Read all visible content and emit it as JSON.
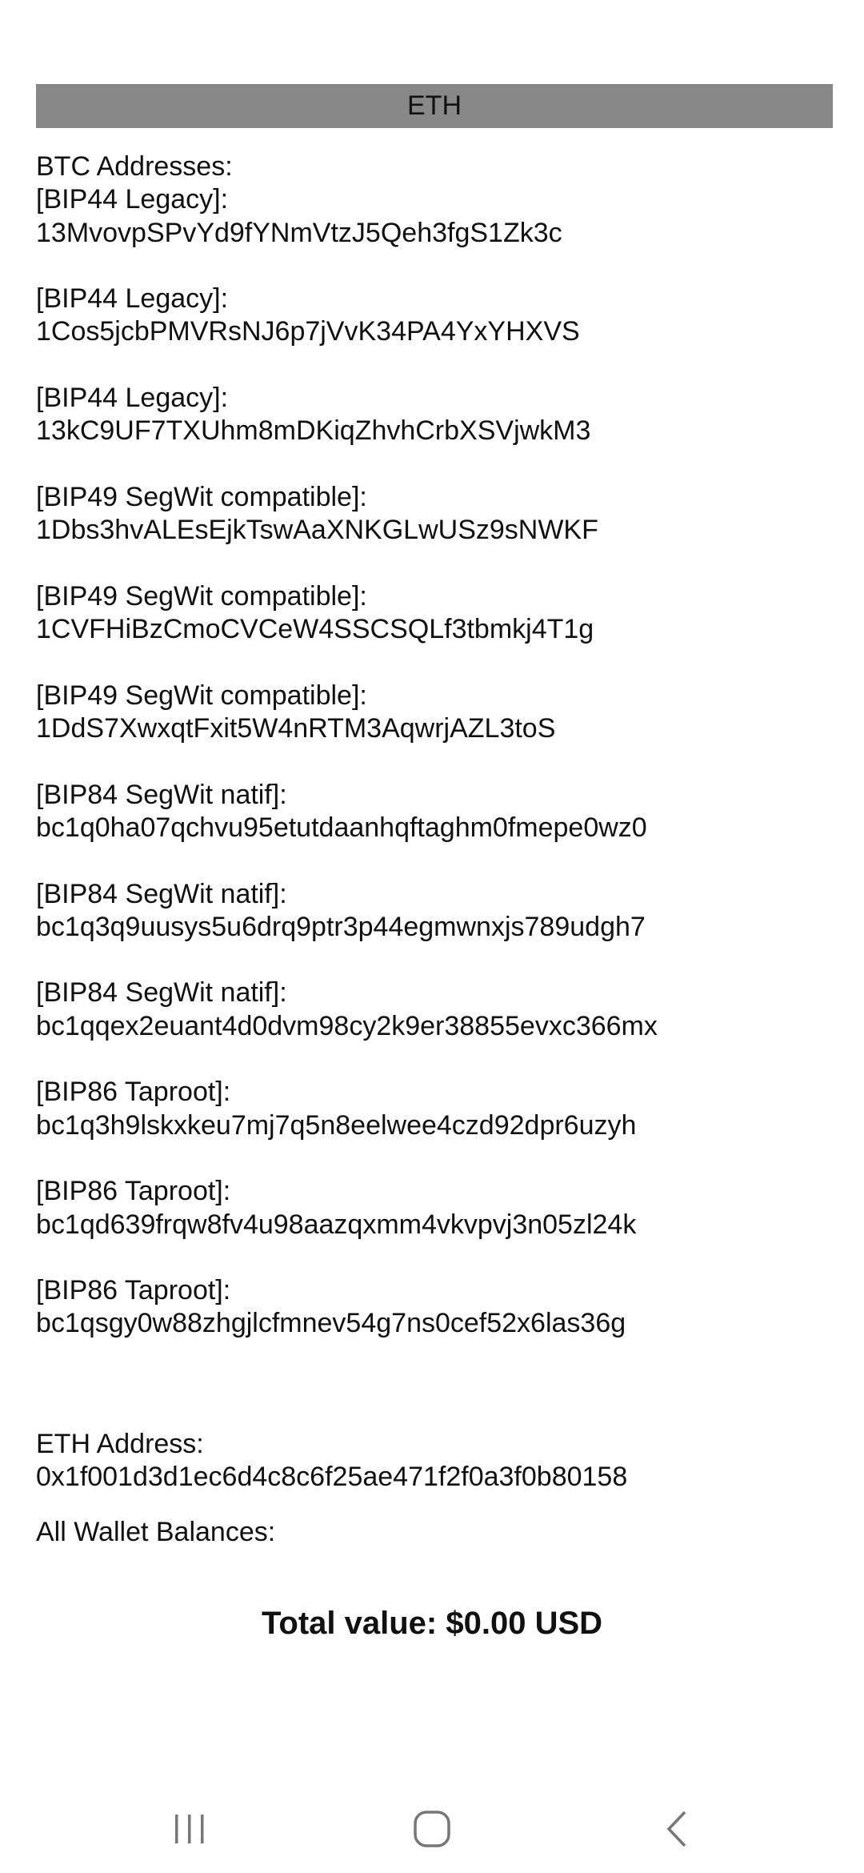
{
  "header": {
    "title": "ETH"
  },
  "btc": {
    "heading": "BTC Addresses:",
    "entries": [
      {
        "label": "[BIP44 Legacy]:",
        "address": "13MvovpSPvYd9fYNmVtzJ5Qeh3fgS1Zk3c"
      },
      {
        "label": "[BIP44 Legacy]:",
        "address": "1Cos5jcbPMVRsNJ6p7jVvK34PA4YxYHXVS"
      },
      {
        "label": "[BIP44 Legacy]:",
        "address": "13kC9UF7TXUhm8mDKiqZhvhCrbXSVjwkM3"
      },
      {
        "label": "[BIP49 SegWit compatible]:",
        "address": "1Dbs3hvALEsEjkTswAaXNKGLwUSz9sNWKF"
      },
      {
        "label": "[BIP49 SegWit compatible]:",
        "address": "1CVFHiBzCmoCVCeW4SSCSQLf3tbmkj4T1g"
      },
      {
        "label": "[BIP49 SegWit compatible]:",
        "address": "1DdS7XwxqtFxit5W4nRTM3AqwrjAZL3toS"
      },
      {
        "label": "[BIP84 SegWit natif]:",
        "address": "bc1q0ha07qchvu95etutdaanhqftaghm0fmepe0wz0"
      },
      {
        "label": "[BIP84 SegWit natif]:",
        "address": "bc1q3q9uusys5u6drq9ptr3p44egmwnxjs789udgh7"
      },
      {
        "label": "[BIP84 SegWit natif]:",
        "address": "bc1qqex2euant4d0dvm98cy2k9er38855evxc366mx"
      },
      {
        "label": "[BIP86 Taproot]:",
        "address": "bc1q3h9lskxkeu7mj7q5n8eelwee4czd92dpr6uzyh"
      },
      {
        "label": "[BIP86 Taproot]:",
        "address": "bc1qd639frqw8fv4u98aazqxmm4vkvpvj3n05zl24k"
      },
      {
        "label": "[BIP86 Taproot]:",
        "address": "bc1qsgy0w88zhgjlcfmnev54g7ns0cef52x6las36g"
      }
    ]
  },
  "eth": {
    "heading": "ETH Address:",
    "address": "0x1f001d3d1ec6d4c8c6f25ae471f2f0a3f0b80158"
  },
  "balances": {
    "heading": "All Wallet Balances:"
  },
  "total": {
    "text": "Total value: $0.00 USD"
  },
  "navbar": {
    "icons": [
      "recent-apps-icon",
      "home-icon",
      "back-icon"
    ]
  }
}
